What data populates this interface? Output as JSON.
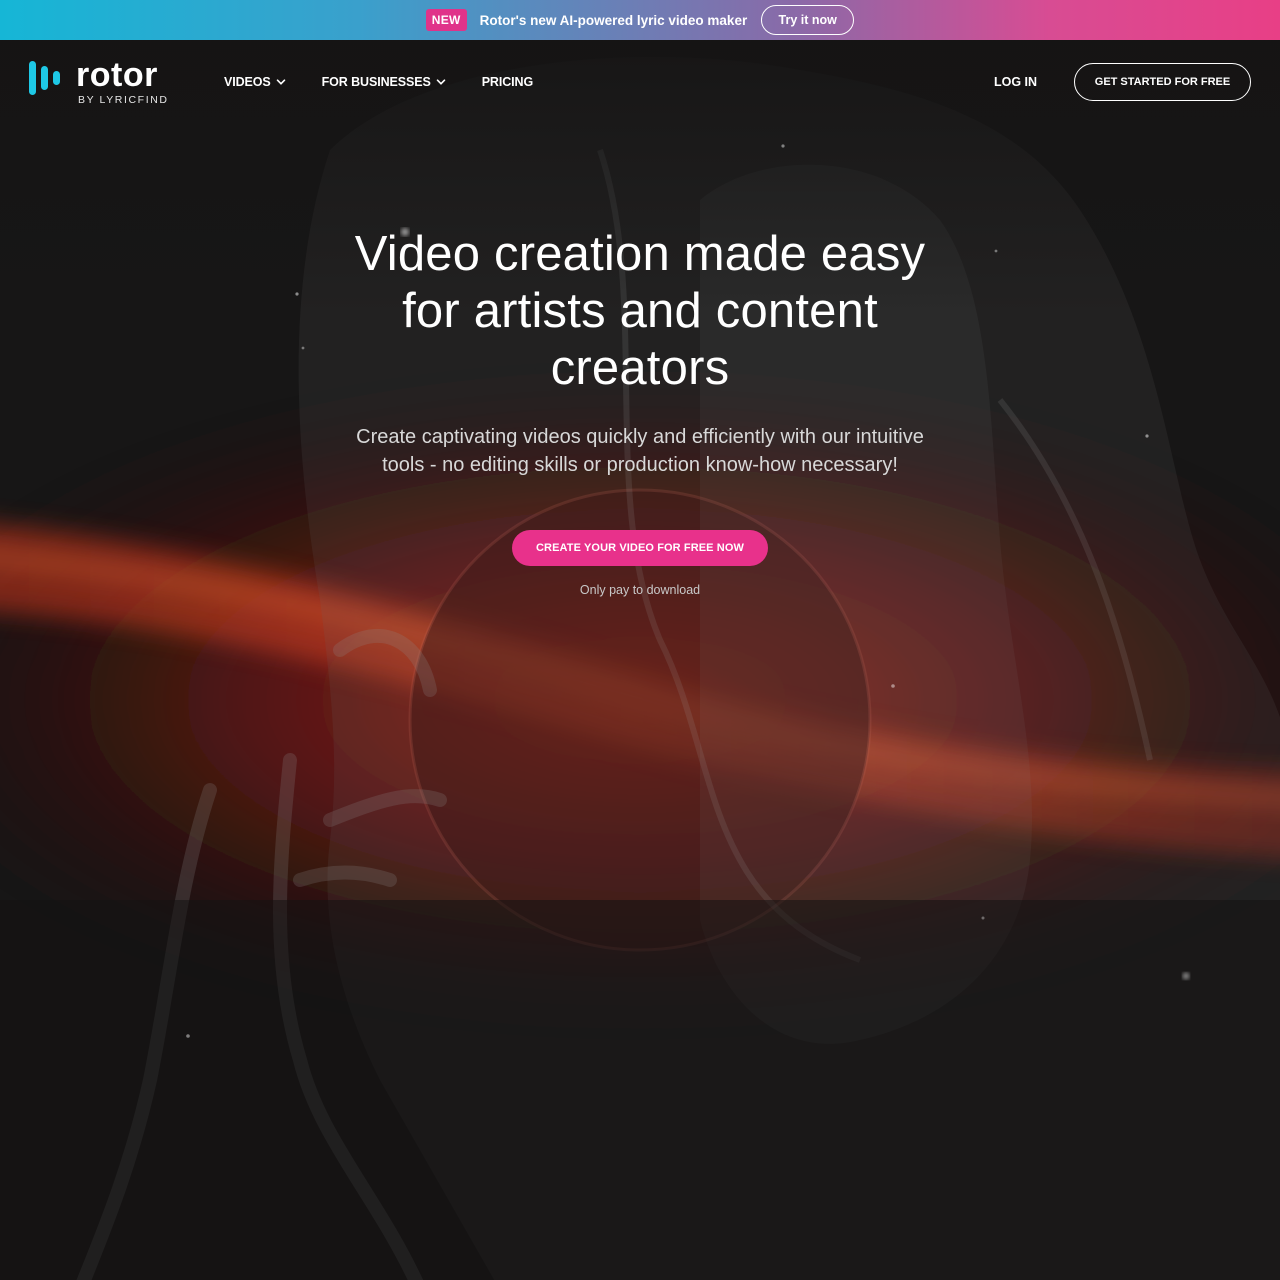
{
  "announcement": {
    "badge": "NEW",
    "text": "Rotor's new AI-powered lyric video maker",
    "button": "Try it now"
  },
  "brand": {
    "name": "rotor",
    "tagline": "BY LYRICFIND",
    "logo_color": "#1ec8e6"
  },
  "nav": {
    "items": [
      {
        "label": "VIDEOS",
        "has_dropdown": true
      },
      {
        "label": "FOR BUSINESSES",
        "has_dropdown": true
      },
      {
        "label": "PRICING",
        "has_dropdown": false
      }
    ],
    "login": "LOG IN",
    "cta": "GET STARTED FOR FREE"
  },
  "hero": {
    "title": "Video creation made easy for artists and content creators",
    "subtitle": "Create captivating videos quickly and efficiently with our intuitive tools - no editing skills or production know-how necessary!",
    "cta": "CREATE YOUR VIDEO FOR FREE NOW",
    "note": "Only pay to download"
  },
  "colors": {
    "accent": "#e8318b",
    "background": "#161515"
  }
}
